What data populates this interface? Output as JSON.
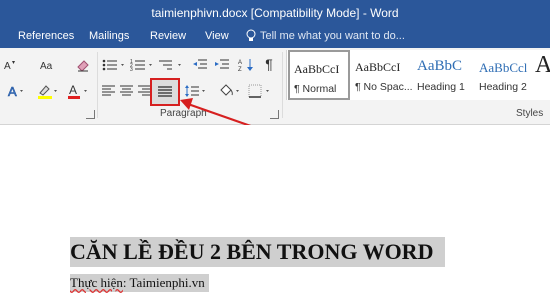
{
  "window": {
    "title": "taimienphivn.docx [Compatibility Mode] - Word"
  },
  "tabs": [
    "References",
    "Mailings",
    "Review",
    "View"
  ],
  "tell_me": {
    "placeholder": "Tell me what you want to do..."
  },
  "ribbon": {
    "paragraph_group_label": "Paragraph",
    "styles_group_label": "Styles",
    "pilcrow": "¶",
    "style_items": [
      {
        "sample": "AaBbCcI",
        "label": "¶ Normal"
      },
      {
        "sample": "AaBbCcI",
        "label": "¶ No Spac..."
      },
      {
        "sample": "AaBbC",
        "label": "Heading 1"
      },
      {
        "sample": "AaBbCcl",
        "label": "Heading 2"
      },
      {
        "sample": "A",
        "label": ""
      }
    ],
    "highlighted_button": "justify"
  },
  "document": {
    "heading": "CĂN LỀ ĐỀU 2 BÊN TRONG WORD",
    "subline_prefix": "Thực hiện",
    "subline_rest": ": Taimienphi.vn"
  },
  "colors": {
    "title_bar": "#2b579a",
    "ribbon": "#f3f3f3",
    "annotation": "#d62020",
    "selection": "#cfcfcf"
  }
}
